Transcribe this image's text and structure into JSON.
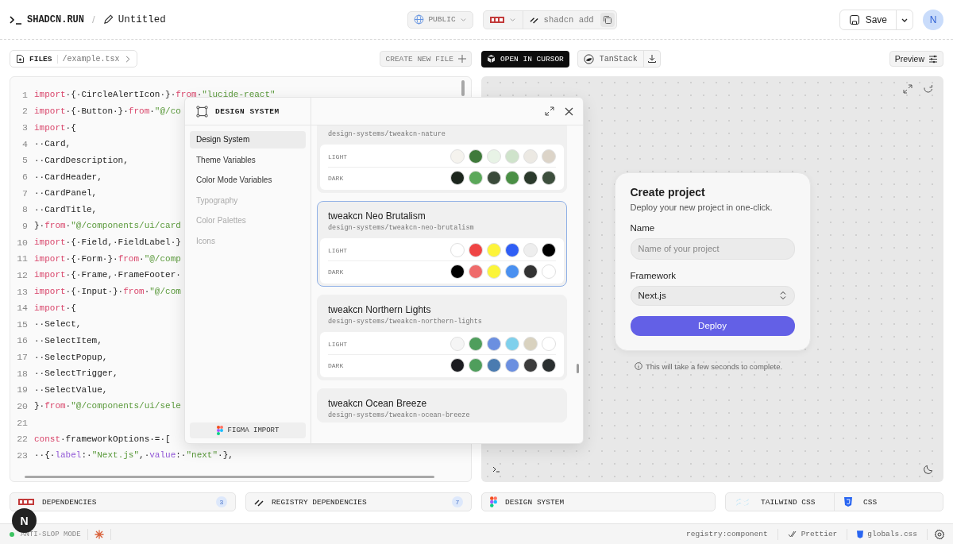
{
  "header": {
    "logo": "SHADCN.RUN",
    "separator": "/",
    "title": "Untitled",
    "visibility": "PUBLIC",
    "command": "shadcn add",
    "save": "Save",
    "avatar": "N"
  },
  "files_bar": {
    "label": "FILES",
    "path": "/example.tsx",
    "create": "CREATE NEW FILE"
  },
  "preview_bar": {
    "open_in": "OPEN IN CURSOR",
    "framework": "TanStack",
    "preview": "Preview"
  },
  "editor": {
    "lines": [
      {
        "n": "1",
        "tokens": [
          {
            "kind": "kw",
            "text": "import"
          },
          {
            "kind": "plain",
            "text": "·{·CircleAlertIcon·}·"
          },
          {
            "kind": "kw",
            "text": "from"
          },
          {
            "kind": "plain",
            "text": "·"
          },
          {
            "kind": "str",
            "text": "\"lucide-react\""
          }
        ]
      },
      {
        "n": "2",
        "tokens": [
          {
            "kind": "kw",
            "text": "import"
          },
          {
            "kind": "plain",
            "text": "·{·Button·}·"
          },
          {
            "kind": "kw",
            "text": "from"
          },
          {
            "kind": "plain",
            "text": "·"
          },
          {
            "kind": "str",
            "text": "\"@/co"
          }
        ]
      },
      {
        "n": "3",
        "tokens": [
          {
            "kind": "kw",
            "text": "import"
          },
          {
            "kind": "plain",
            "text": "·{"
          }
        ]
      },
      {
        "n": "4",
        "tokens": [
          {
            "kind": "plain",
            "text": "··Card,"
          }
        ]
      },
      {
        "n": "5",
        "tokens": [
          {
            "kind": "plain",
            "text": "··CardDescription,"
          }
        ]
      },
      {
        "n": "6",
        "tokens": [
          {
            "kind": "plain",
            "text": "··CardHeader,"
          }
        ]
      },
      {
        "n": "7",
        "tokens": [
          {
            "kind": "plain",
            "text": "··CardPanel,"
          }
        ]
      },
      {
        "n": "8",
        "tokens": [
          {
            "kind": "plain",
            "text": "··CardTitle,"
          }
        ]
      },
      {
        "n": "9",
        "tokens": [
          {
            "kind": "plain",
            "text": "}·"
          },
          {
            "kind": "kw",
            "text": "from"
          },
          {
            "kind": "plain",
            "text": "·"
          },
          {
            "kind": "str",
            "text": "\"@/components/ui/card"
          }
        ]
      },
      {
        "n": "10",
        "tokens": [
          {
            "kind": "kw",
            "text": "import"
          },
          {
            "kind": "plain",
            "text": "·{·Field,·FieldLabel·}"
          }
        ]
      },
      {
        "n": "11",
        "tokens": [
          {
            "kind": "kw",
            "text": "import"
          },
          {
            "kind": "plain",
            "text": "·{·Form·}·"
          },
          {
            "kind": "kw",
            "text": "from"
          },
          {
            "kind": "plain",
            "text": "·"
          },
          {
            "kind": "str",
            "text": "\"@/comp"
          }
        ]
      },
      {
        "n": "12",
        "tokens": [
          {
            "kind": "kw",
            "text": "import"
          },
          {
            "kind": "plain",
            "text": "·{·Frame,·FrameFooter·"
          }
        ]
      },
      {
        "n": "13",
        "tokens": [
          {
            "kind": "kw",
            "text": "import"
          },
          {
            "kind": "plain",
            "text": "·{·Input·}·"
          },
          {
            "kind": "kw",
            "text": "from"
          },
          {
            "kind": "plain",
            "text": "·"
          },
          {
            "kind": "str",
            "text": "\"@/com"
          }
        ]
      },
      {
        "n": "14",
        "tokens": [
          {
            "kind": "kw",
            "text": "import"
          },
          {
            "kind": "plain",
            "text": "·{"
          }
        ]
      },
      {
        "n": "15",
        "tokens": [
          {
            "kind": "plain",
            "text": "··Select,"
          }
        ]
      },
      {
        "n": "16",
        "tokens": [
          {
            "kind": "plain",
            "text": "··SelectItem,"
          }
        ]
      },
      {
        "n": "17",
        "tokens": [
          {
            "kind": "plain",
            "text": "··SelectPopup,"
          }
        ]
      },
      {
        "n": "18",
        "tokens": [
          {
            "kind": "plain",
            "text": "··SelectTrigger,"
          }
        ]
      },
      {
        "n": "19",
        "tokens": [
          {
            "kind": "plain",
            "text": "··SelectValue,"
          }
        ]
      },
      {
        "n": "20",
        "tokens": [
          {
            "kind": "plain",
            "text": "}·"
          },
          {
            "kind": "kw",
            "text": "from"
          },
          {
            "kind": "plain",
            "text": "·"
          },
          {
            "kind": "str",
            "text": "\"@/components/ui/sele"
          }
        ]
      },
      {
        "n": "21"
      },
      {
        "n": "22",
        "tokens": [
          {
            "kind": "kw",
            "text": "const"
          },
          {
            "kind": "plain",
            "text": "·frameworkOptions·=·["
          }
        ]
      },
      {
        "n": "23",
        "tokens": [
          {
            "kind": "plain",
            "text": "··{·"
          },
          {
            "kind": "prop",
            "text": "label"
          },
          {
            "kind": "plain",
            "text": ":·"
          },
          {
            "kind": "str",
            "text": "\"Next.js\""
          },
          {
            "kind": "plain",
            "text": ",·"
          },
          {
            "kind": "prop",
            "text": "value"
          },
          {
            "kind": "plain",
            "text": ":·"
          },
          {
            "kind": "str",
            "text": "\"next\""
          },
          {
            "kind": "plain",
            "text": "·},"
          }
        ]
      }
    ]
  },
  "dialog": {
    "title": "DESIGN SYSTEM",
    "nav": [
      {
        "label": "Design System",
        "selected": true,
        "disabled": false
      },
      {
        "label": "Theme Variables",
        "selected": false,
        "disabled": false
      },
      {
        "label": "Color Mode Variables",
        "selected": false,
        "disabled": false
      },
      {
        "label": "Typography",
        "selected": false,
        "disabled": true
      },
      {
        "label": "Color Palettes",
        "selected": false,
        "disabled": true
      },
      {
        "label": "Icons",
        "selected": false,
        "disabled": true
      }
    ],
    "import": "FIGMA IMPORT",
    "cards": [
      {
        "path": "design-systems/tweakcn-nature",
        "selected": false,
        "modes": [
          {
            "label": "LIGHT",
            "swatches": [
              {
                "color": "#f5f3ee"
              },
              {
                "color": "#3f7a3a"
              },
              {
                "color": "#e8f3e6"
              },
              {
                "color": "#cfe3cb"
              },
              {
                "color": "#ece9e3"
              },
              {
                "color": "#dcd4c8"
              }
            ]
          },
          {
            "label": "DARK",
            "swatches": [
              {
                "color": "#1c261d"
              },
              {
                "color": "#5ba85a"
              },
              {
                "color": "#3a4a3a"
              },
              {
                "color": "#4a8f45"
              },
              {
                "color": "#2b3a2c"
              },
              {
                "color": "#3d4f3d"
              }
            ]
          }
        ]
      },
      {
        "name": "tweakcn Neo Brutalism",
        "path": "design-systems/tweakcn-neo-brutalism",
        "selected": true,
        "modes": [
          {
            "label": "LIGHT",
            "swatches": [
              {
                "color": "#ffffff"
              },
              {
                "color": "#ef4444"
              },
              {
                "color": "#fdf43a"
              },
              {
                "color": "#2f5ef5"
              },
              {
                "color": "#eeeeee"
              },
              {
                "color": "#000000"
              }
            ]
          },
          {
            "label": "DARK",
            "swatches": [
              {
                "color": "#000000"
              },
              {
                "color": "#ef6b6b"
              },
              {
                "color": "#fbf53a"
              },
              {
                "color": "#4a90f0"
              },
              {
                "color": "#333333"
              },
              {
                "color": "#ffffff"
              }
            ]
          }
        ]
      },
      {
        "name": "tweakcn Northern Lights",
        "path": "design-systems/tweakcn-northern-lights",
        "selected": false,
        "modes": [
          {
            "label": "LIGHT",
            "swatches": [
              {
                "color": "#f5f5f5"
              },
              {
                "color": "#4f9e5c"
              },
              {
                "color": "#6b8fe0"
              },
              {
                "color": "#7fd0ec"
              },
              {
                "color": "#d9d2bf"
              },
              {
                "color": "#ffffff"
              }
            ]
          },
          {
            "label": "DARK",
            "swatches": [
              {
                "color": "#1c1d21"
              },
              {
                "color": "#4f9e5c"
              },
              {
                "color": "#4a7bb0"
              },
              {
                "color": "#6b8fe0"
              },
              {
                "color": "#3c3c3c"
              },
              {
                "color": "#2a2f30"
              }
            ]
          }
        ]
      },
      {
        "name": "tweakcn Ocean Breeze",
        "path": "design-systems/tweakcn-ocean-breeze",
        "selected": false
      }
    ]
  },
  "preview": {
    "title": "Create project",
    "description": "Deploy your new project in one-click.",
    "name_label": "Name",
    "name_placeholder": "Name of your project",
    "framework_label": "Framework",
    "framework_value": "Next.js",
    "button": "Deploy",
    "hint": "This will take a few seconds to complete."
  },
  "panels": [
    {
      "kind": "npm",
      "label": "DEPENDENCIES",
      "count": "3"
    },
    {
      "kind": "registry",
      "label": "REGISTRY DEPENDENCIES",
      "count": "7"
    },
    {
      "kind": "figma",
      "label": "DESIGN SYSTEM"
    },
    {
      "kind": "split",
      "parts": [
        {
          "kind": "tailwind",
          "label": "TAILWIND CSS"
        },
        {
          "kind": "css",
          "label": "CSS"
        }
      ]
    }
  ],
  "status_bar": {
    "mode": {
      "label": "ANTI-SLOP MODE",
      "on": true
    },
    "items": [
      {
        "kind": "text",
        "label": "registry:component"
      },
      {
        "kind": "prettier",
        "label": "Prettier"
      },
      {
        "kind": "css",
        "label": "globals.css"
      }
    ]
  },
  "dev_badge": "N"
}
